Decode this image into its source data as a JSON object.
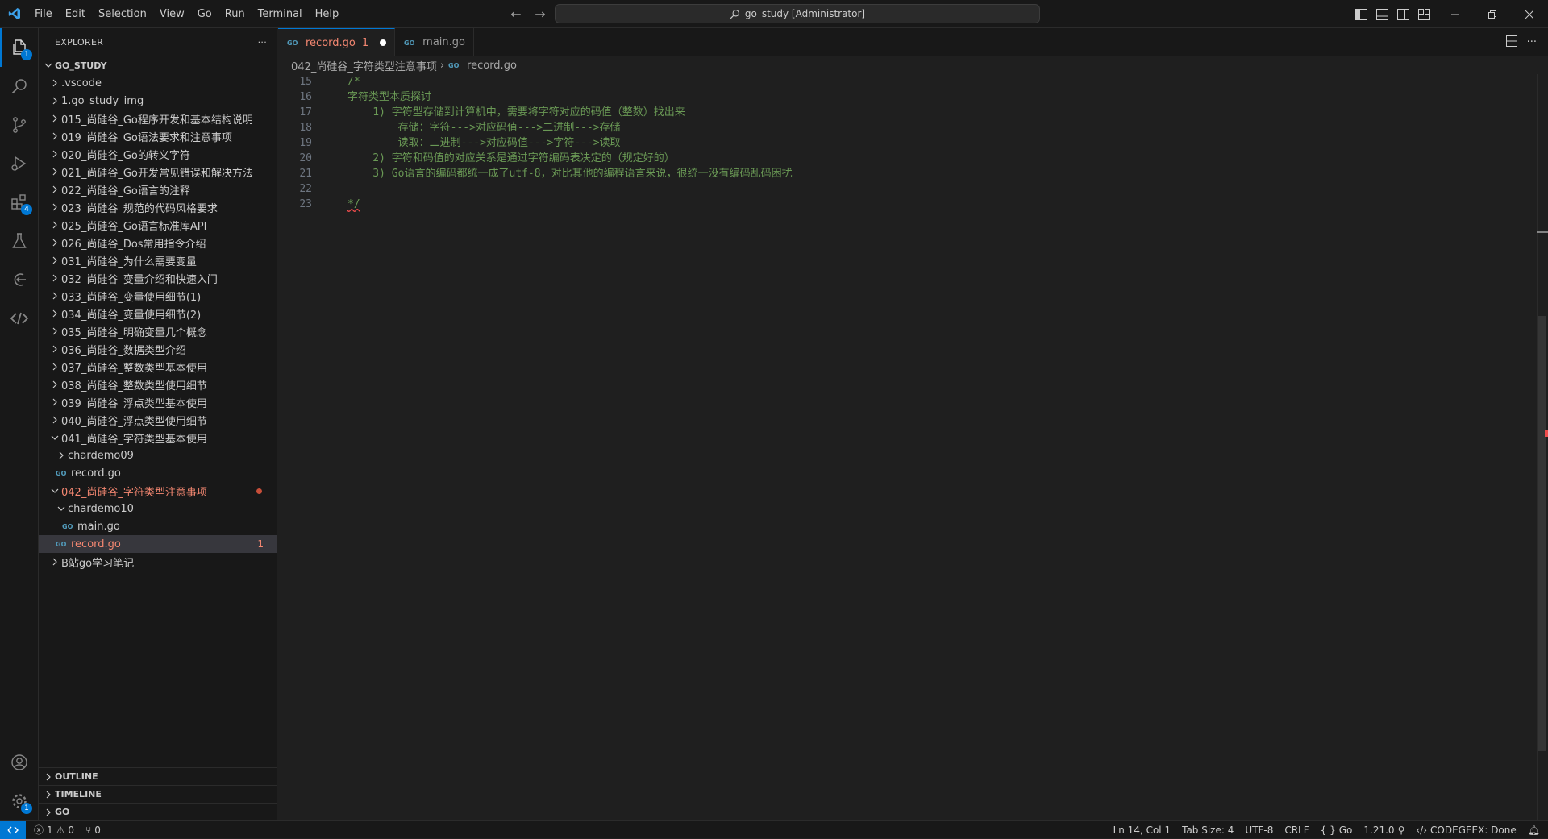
{
  "menu": [
    "File",
    "Edit",
    "Selection",
    "View",
    "Go",
    "Run",
    "Terminal",
    "Help"
  ],
  "command_center": "go_study [Administrator]",
  "activity_badges": {
    "explorer": "1",
    "extensions": "4",
    "settings": "1"
  },
  "explorer": {
    "title": "EXPLORER",
    "more": "···",
    "root": "GO_STUDY",
    "items": [
      {
        "label": ".vscode",
        "type": "folder",
        "depth": 0,
        "expanded": false
      },
      {
        "label": "1.go_study_img",
        "type": "folder",
        "depth": 0,
        "expanded": false
      },
      {
        "label": "015_尚硅谷_Go程序开发和基本结构说明",
        "type": "folder",
        "depth": 0,
        "expanded": false
      },
      {
        "label": "019_尚硅谷_Go语法要求和注意事项",
        "type": "folder",
        "depth": 0,
        "expanded": false
      },
      {
        "label": "020_尚硅谷_Go的转义字符",
        "type": "folder",
        "depth": 0,
        "expanded": false
      },
      {
        "label": "021_尚硅谷_Go开发常见错误和解决方法",
        "type": "folder",
        "depth": 0,
        "expanded": false
      },
      {
        "label": "022_尚硅谷_Go语言的注释",
        "type": "folder",
        "depth": 0,
        "expanded": false
      },
      {
        "label": "023_尚硅谷_规范的代码风格要求",
        "type": "folder",
        "depth": 0,
        "expanded": false
      },
      {
        "label": "025_尚硅谷_Go语言标准库API",
        "type": "folder",
        "depth": 0,
        "expanded": false
      },
      {
        "label": "026_尚硅谷_Dos常用指令介绍",
        "type": "folder",
        "depth": 0,
        "expanded": false
      },
      {
        "label": "031_尚硅谷_为什么需要变量",
        "type": "folder",
        "depth": 0,
        "expanded": false
      },
      {
        "label": "032_尚硅谷_变量介绍和快速入门",
        "type": "folder",
        "depth": 0,
        "expanded": false
      },
      {
        "label": "033_尚硅谷_变量使用细节(1)",
        "type": "folder",
        "depth": 0,
        "expanded": false
      },
      {
        "label": "034_尚硅谷_变量使用细节(2)",
        "type": "folder",
        "depth": 0,
        "expanded": false
      },
      {
        "label": "035_尚硅谷_明确变量几个概念",
        "type": "folder",
        "depth": 0,
        "expanded": false
      },
      {
        "label": "036_尚硅谷_数据类型介绍",
        "type": "folder",
        "depth": 0,
        "expanded": false
      },
      {
        "label": "037_尚硅谷_整数类型基本使用",
        "type": "folder",
        "depth": 0,
        "expanded": false
      },
      {
        "label": "038_尚硅谷_整数类型使用细节",
        "type": "folder",
        "depth": 0,
        "expanded": false
      },
      {
        "label": "039_尚硅谷_浮点类型基本使用",
        "type": "folder",
        "depth": 0,
        "expanded": false
      },
      {
        "label": "040_尚硅谷_浮点类型使用细节",
        "type": "folder",
        "depth": 0,
        "expanded": false
      },
      {
        "label": "041_尚硅谷_字符类型基本使用",
        "type": "folder",
        "depth": 0,
        "expanded": true
      },
      {
        "label": "chardemo09",
        "type": "folder",
        "depth": 1,
        "expanded": false
      },
      {
        "label": "record.go",
        "type": "go",
        "depth": 1
      },
      {
        "label": "042_尚硅谷_字符类型注意事项",
        "type": "folder",
        "depth": 0,
        "expanded": true,
        "modified": true
      },
      {
        "label": "chardemo10",
        "type": "folder",
        "depth": 1,
        "expanded": true
      },
      {
        "label": "main.go",
        "type": "go",
        "depth": 2
      },
      {
        "label": "record.go",
        "type": "go",
        "depth": 1,
        "selected": true,
        "modified": true,
        "problems": "1"
      },
      {
        "label": "B站go学习笔记",
        "type": "folder",
        "depth": 0,
        "expanded": false
      }
    ],
    "bottom_sections": [
      "OUTLINE",
      "TIMELINE",
      "GO"
    ]
  },
  "tabs": [
    {
      "label": "record.go",
      "problems": "1",
      "active": true,
      "dirty": true
    },
    {
      "label": "main.go",
      "active": false
    }
  ],
  "breadcrumb": {
    "folder": "042_尚硅谷_字符类型注意事项",
    "sep": "›",
    "file": "record.go"
  },
  "code_lines": [
    {
      "n": "15",
      "text": "/*"
    },
    {
      "n": "16",
      "text": "字符类型本质探讨"
    },
    {
      "n": "17",
      "text": "    1) 字符型存储到计算机中，需要将字符对应的码值（整数）找出来"
    },
    {
      "n": "18",
      "text": "        存储：字符--->对应码值--->二进制--->存储"
    },
    {
      "n": "19",
      "text": "        读取：二进制--->对应码值--->字符--->读取"
    },
    {
      "n": "20",
      "text": "    2) 字符和码值的对应关系是通过字符编码表决定的（规定好的）"
    },
    {
      "n": "21",
      "text": "    3) Go语言的编码都统一成了utf-8，对比其他的编程语言来说，很统一没有编码乱码困扰"
    },
    {
      "n": "22",
      "text": ""
    },
    {
      "n": "23",
      "text": "*/",
      "squiggle": true
    }
  ],
  "status": {
    "errors": "1",
    "warnings": "0",
    "ports": "0",
    "position": "Ln 14, Col 1",
    "tab_size": "Tab Size: 4",
    "encoding": "UTF-8",
    "eol": "CRLF",
    "language": "Go",
    "go_version": "1.21.0",
    "codegeex": "CODEGEEX: Done"
  },
  "colors": {
    "accent": "#0078d4",
    "modified": "#f48771",
    "comment": "#6a9955"
  }
}
